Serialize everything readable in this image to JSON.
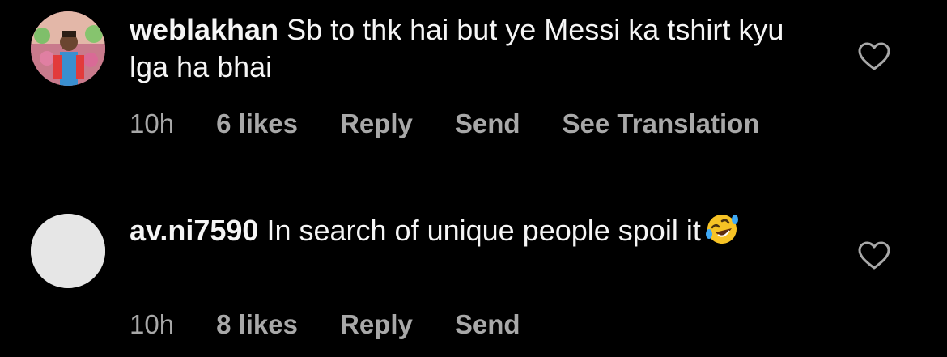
{
  "comments": [
    {
      "username": "weblakhan",
      "text": "Sb to thk hai but ye Messi ka tshirt kyu lga ha bhai",
      "time": "10h",
      "likes": "6 likes",
      "reply_label": "Reply",
      "send_label": "Send",
      "translate_label": "See Translation",
      "avatar": "profile-photo"
    },
    {
      "username": "av.ni7590",
      "text": "In search of unique people spoil it",
      "emoji": "rolling-on-floor-laughing",
      "time": "10h",
      "likes": "8 likes",
      "reply_label": "Reply",
      "send_label": "Send",
      "avatar": "default-avatar"
    }
  ],
  "colors": {
    "background": "#000000",
    "primary_text": "#f5f5f5",
    "secondary_text": "#a8a8a8"
  }
}
